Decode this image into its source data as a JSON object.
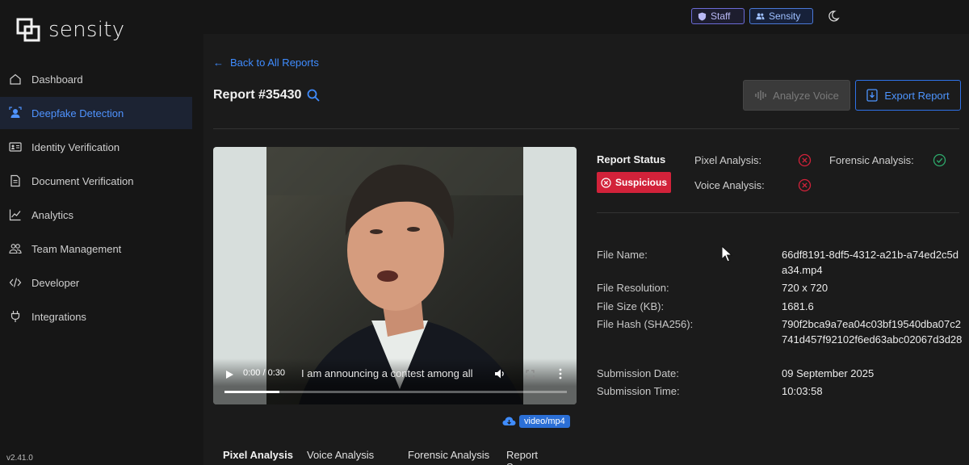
{
  "app": {
    "name": "sensity",
    "version": "v2.41.0"
  },
  "topbar": {
    "badge_staff": "Staff",
    "badge_team": "Sensity",
    "theme_icon": "moon-icon"
  },
  "sidebar": {
    "items": [
      {
        "label": "Dashboard",
        "icon": "home-icon",
        "active": false
      },
      {
        "label": "Deepfake Detection",
        "icon": "user-scan-icon",
        "active": true
      },
      {
        "label": "Identity Verification",
        "icon": "id-card-icon",
        "active": false
      },
      {
        "label": "Document Verification",
        "icon": "document-icon",
        "active": false
      },
      {
        "label": "Analytics",
        "icon": "chart-line-icon",
        "active": false
      },
      {
        "label": "Team Management",
        "icon": "team-icon",
        "active": false
      },
      {
        "label": "Developer",
        "icon": "code-icon",
        "active": false
      },
      {
        "label": "Integrations",
        "icon": "plug-icon",
        "active": false
      }
    ]
  },
  "main": {
    "back_label": "Back to All Reports",
    "report_title": "Report #35430",
    "analyze_voice_label": "Analyze Voice",
    "export_label": "Export Report"
  },
  "video": {
    "timecode": "0:00 / 0:30",
    "caption": "I am announcing a contest among all",
    "progress": 0.16,
    "mime": "video/mp4"
  },
  "tabs": [
    "Pixel Analysis",
    "Voice Analysis",
    "Forensic Analysis",
    "Report Summary"
  ],
  "status": {
    "label": "Report Status",
    "value": "Suspicious",
    "pixel_label": "Pixel Analysis:",
    "pixel_result": "fail",
    "voice_label": "Voice Analysis:",
    "voice_result": "fail",
    "forensic_label": "Forensic Analysis:",
    "forensic_result": "pass",
    "colors": {
      "fail": "#d2223a",
      "pass": "#2ea96b",
      "accent": "#3f8cff"
    }
  },
  "file_info": {
    "name_label": "File Name:",
    "name_value": "66df8191-8df5-4312-a21b-a74ed2c5da34.mp4",
    "resolution_label": "File Resolution:",
    "resolution_value": "720 x 720",
    "size_label": "File Size (KB):",
    "size_value": "1681.6",
    "hash_label": "File Hash (SHA256):",
    "hash_value": "790f2bca9a7ea04c03bf19540dba07c2741d457f92102f6ed63abc02067d3d28",
    "date_label": "Submission Date:",
    "date_value": "09 September 2025",
    "time_label": "Submission Time:",
    "time_value": "10:03:58"
  }
}
